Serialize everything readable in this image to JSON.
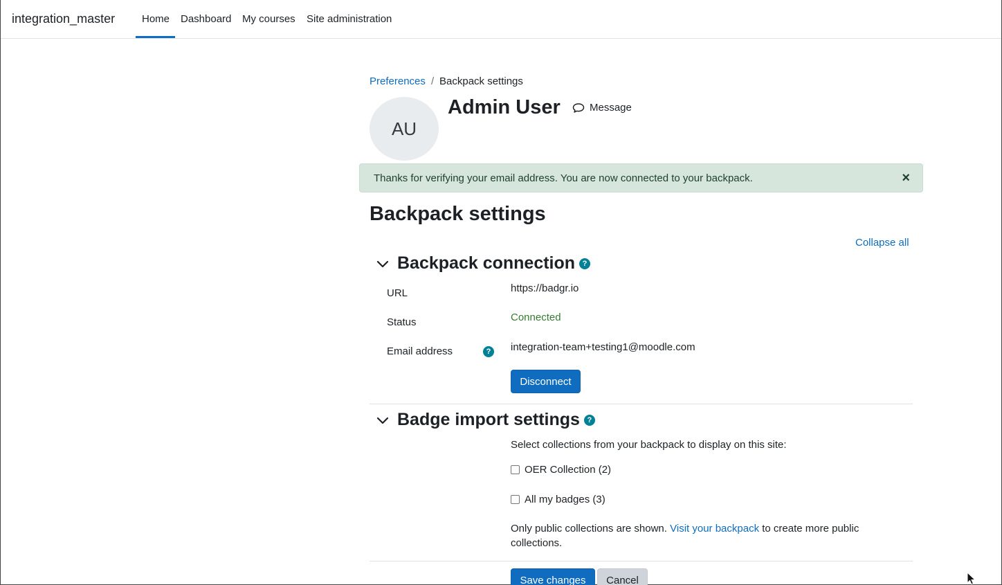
{
  "nav": {
    "brand": "integration_master",
    "items": [
      {
        "label": "Home",
        "active": true
      },
      {
        "label": "Dashboard"
      },
      {
        "label": "My courses"
      },
      {
        "label": "Site administration"
      }
    ]
  },
  "breadcrumb": {
    "parent": "Preferences",
    "separator": "/",
    "current": "Backpack settings"
  },
  "user": {
    "initials": "AU",
    "name": "Admin User",
    "message_label": "Message"
  },
  "alert": {
    "text": "Thanks for verifying your email address. You are now connected to your backpack.",
    "close": "×"
  },
  "page": {
    "title": "Backpack settings",
    "collapse_all": "Collapse all"
  },
  "connection": {
    "title": "Backpack connection",
    "url_label": "URL",
    "url_value": "https://badgr.io",
    "status_label": "Status",
    "status_value": "Connected",
    "email_label": "Email address",
    "email_value": "integration-team+testing1@moodle.com",
    "disconnect": "Disconnect"
  },
  "import": {
    "title": "Badge import settings",
    "instruction": "Select collections from your backpack to display on this site:",
    "collections": [
      {
        "label": "OER Collection (2)",
        "checked": false
      },
      {
        "label": "All my badges (3)",
        "checked": false
      }
    ],
    "note_before": "Only public collections are shown. ",
    "note_link": "Visit your backpack",
    "note_after": " to create more public collections."
  },
  "actions": {
    "save": "Save changes",
    "cancel": "Cancel"
  },
  "colors": {
    "accent": "#0f6cbf",
    "success_text": "#357a32",
    "alert_bg": "#d7e6dc",
    "help_icon": "#008196"
  }
}
